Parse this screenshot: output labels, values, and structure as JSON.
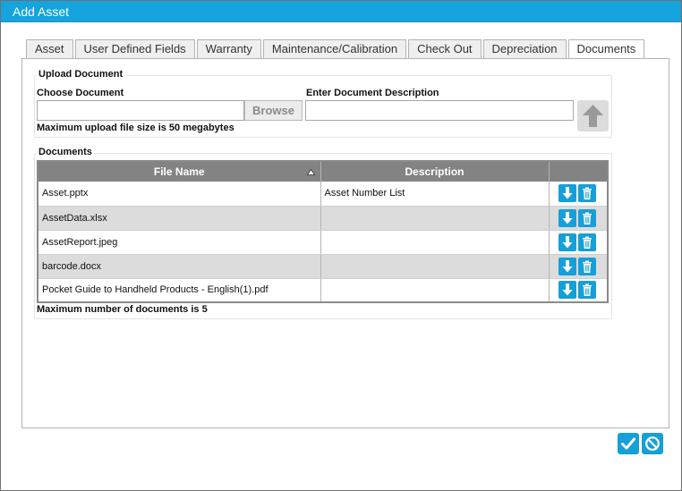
{
  "window": {
    "title": "Add Asset"
  },
  "tabs": [
    {
      "label": "Asset"
    },
    {
      "label": "User Defined Fields"
    },
    {
      "label": "Warranty"
    },
    {
      "label": "Maintenance/Calibration"
    },
    {
      "label": "Check Out"
    },
    {
      "label": "Depreciation"
    },
    {
      "label": "Documents"
    }
  ],
  "active_tab": "Documents",
  "upload": {
    "legend": "Upload Document",
    "choose_label": "Choose Document",
    "choose_value": "",
    "browse_label": "Browse",
    "description_label": "Enter Document Description",
    "description_value": "",
    "max_size_note": "Maximum upload file size is 50 megabytes",
    "upload_icon": "upload-arrow-icon"
  },
  "documents": {
    "legend": "Documents",
    "columns": {
      "file_name": "File Name",
      "description": "Description"
    },
    "sort_indicator": "▲",
    "rows": [
      {
        "file_name": "Asset.pptx",
        "description": "Asset Number List"
      },
      {
        "file_name": "AssetData.xlsx",
        "description": ""
      },
      {
        "file_name": "AssetReport.jpeg",
        "description": ""
      },
      {
        "file_name": "barcode.docx",
        "description": ""
      },
      {
        "file_name": "Pocket Guide to Handheld Products - English(1).pdf",
        "description": ""
      }
    ],
    "max_docs_note": "Maximum number of documents is 5"
  },
  "colors": {
    "accent": "#15a4dd",
    "header": "#838383",
    "alt_row": "#dcdcdc"
  }
}
